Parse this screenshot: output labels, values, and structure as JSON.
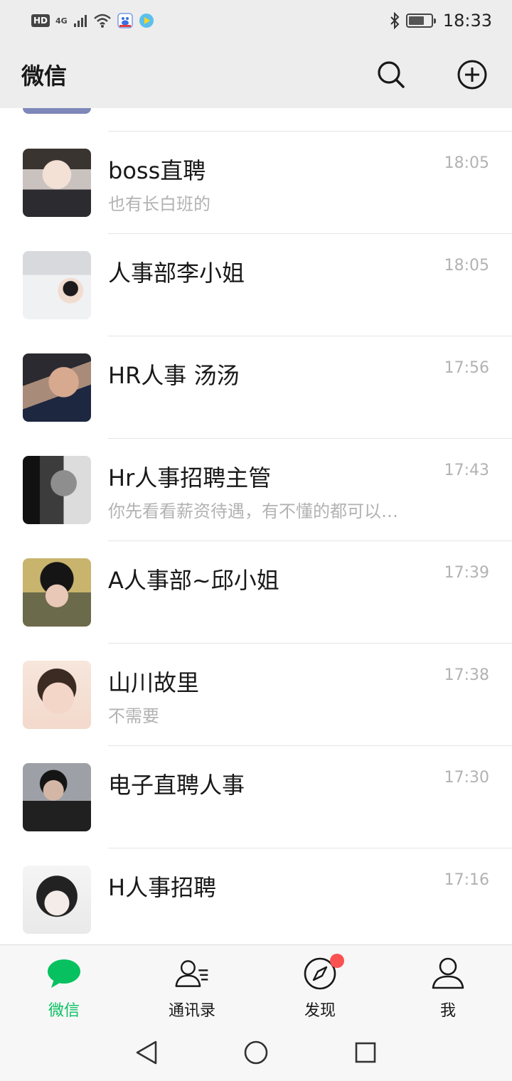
{
  "status_bar": {
    "hd": "HD",
    "network": "4G",
    "time": "18:33"
  },
  "header": {
    "title": "微信"
  },
  "chats": [
    {
      "name": "boss直聘",
      "preview": "也有长白班的",
      "time": "18:05"
    },
    {
      "name": "人事部李小姐",
      "preview": "",
      "time": "18:05"
    },
    {
      "name": "HR人事 汤汤",
      "preview": "",
      "time": "17:56"
    },
    {
      "name": "Hr人事招聘主管",
      "preview": "你先看看薪资待遇，有不懂的都可以…",
      "time": "17:43"
    },
    {
      "name": "A人事部~邱小姐",
      "preview": "",
      "time": "17:39"
    },
    {
      "name": "山川故里",
      "preview": "不需要",
      "time": "17:38"
    },
    {
      "name": "电子直聘人事",
      "preview": "",
      "time": "17:30"
    },
    {
      "name": "H人事招聘",
      "preview": "",
      "time": "17:16"
    }
  ],
  "tabs": [
    {
      "label": "微信",
      "icon": "chat-bubble-icon",
      "active": true
    },
    {
      "label": "通讯录",
      "icon": "contacts-icon",
      "active": false
    },
    {
      "label": "发现",
      "icon": "compass-icon",
      "active": false,
      "badge": "red-dot"
    },
    {
      "label": "我",
      "icon": "person-icon",
      "active": false
    }
  ],
  "colors": {
    "accent": "#07c160",
    "badge": "#fa5151",
    "header_bg": "#ededed",
    "secondary_text": "#b2b2b2"
  }
}
